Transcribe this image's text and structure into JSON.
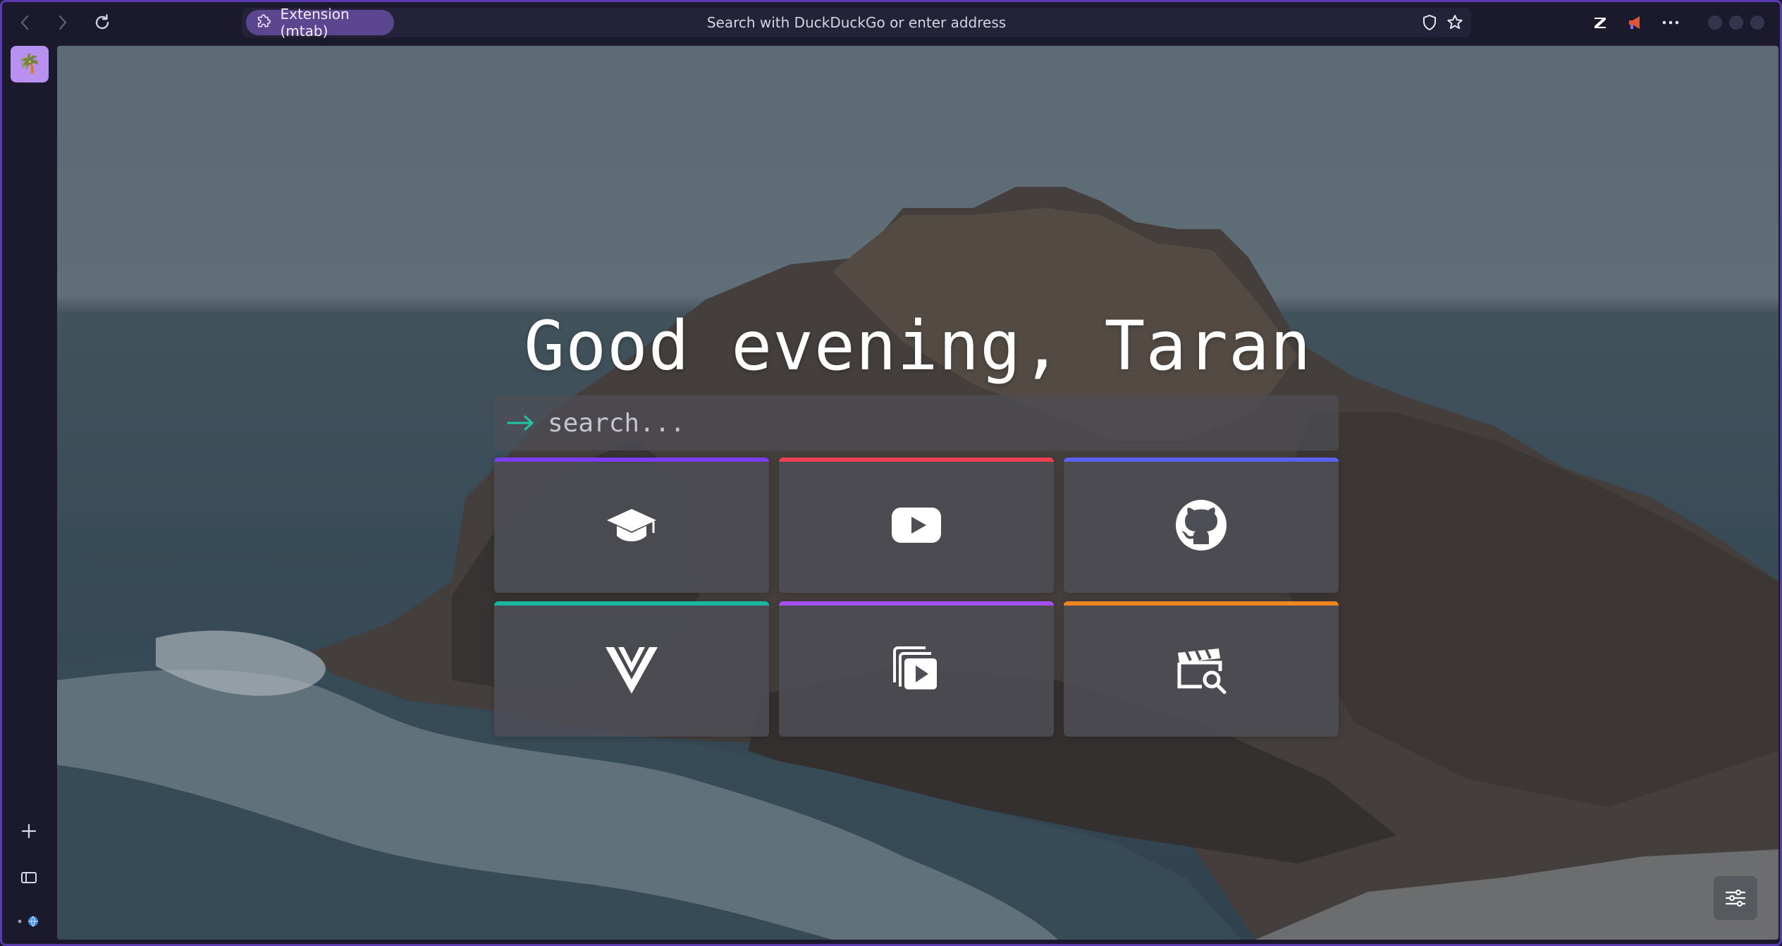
{
  "browser": {
    "extension_label": "Extension (mtab)",
    "address_placeholder": "Search with DuckDuckGo or enter address"
  },
  "sidebar": {
    "space_emoji": "🌴"
  },
  "page": {
    "greeting": "Good evening, Taran",
    "search_placeholder": "search..."
  },
  "tiles": [
    {
      "icon": "graduation-cap-icon",
      "accent": "#7a3df0"
    },
    {
      "icon": "youtube-icon",
      "accent": "#ef3f52"
    },
    {
      "icon": "github-icon",
      "accent": "#5a62f0"
    },
    {
      "icon": "vercel-v-icon",
      "accent": "#18b8a0"
    },
    {
      "icon": "video-library-icon",
      "accent": "#a34ff0"
    },
    {
      "icon": "clapperboard-search-icon",
      "accent": "#f0861e"
    }
  ],
  "colors": {
    "window_border": "#5b3bb0",
    "chrome_bg": "#1b1a2c",
    "search_arrow": "#22c5a6"
  }
}
